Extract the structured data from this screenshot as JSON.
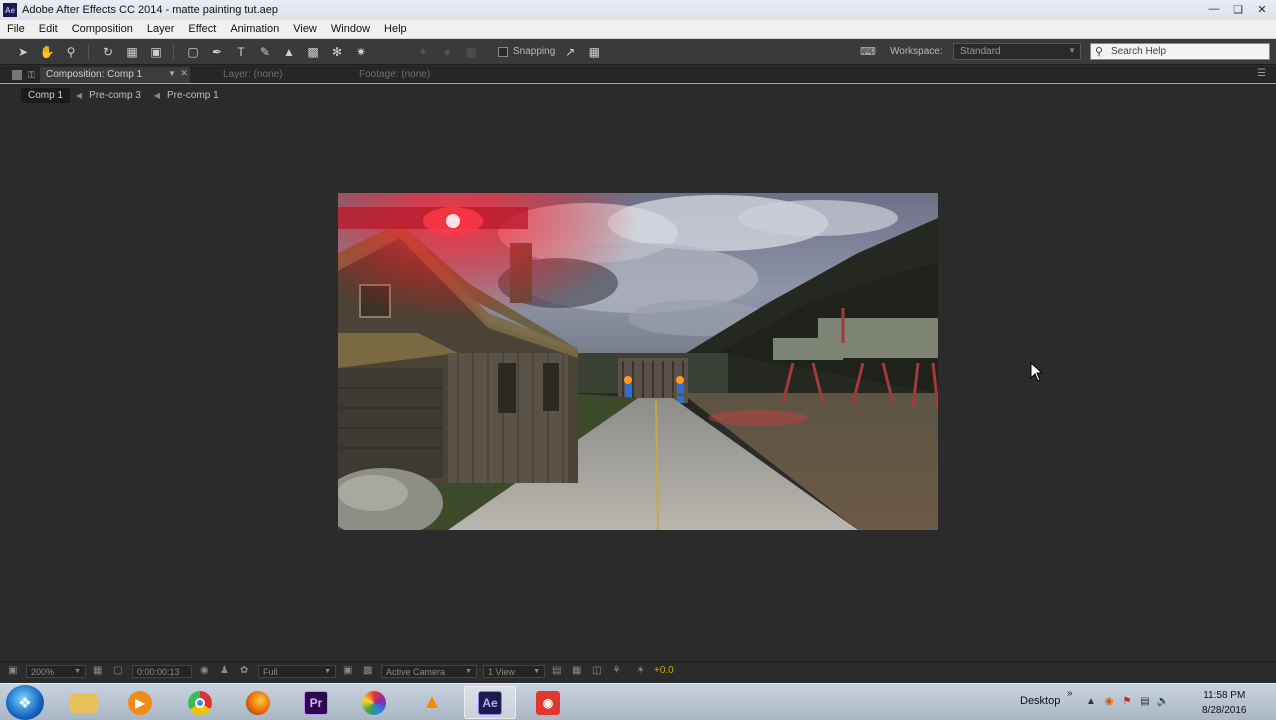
{
  "window": {
    "title": "Adobe After Effects CC 2014 - matte painting tut.aep",
    "app_icon_label": "Ae"
  },
  "menu": [
    "File",
    "Edit",
    "Composition",
    "Layer",
    "Effect",
    "Animation",
    "View",
    "Window",
    "Help"
  ],
  "toolbar": {
    "snapping_label": "Snapping",
    "workspace_label": "Workspace:",
    "workspace_value": "Standard",
    "search_placeholder": "Search Help"
  },
  "panel": {
    "comp_tab": "Composition: Comp 1",
    "layer_tab": "Layer: (none)",
    "footage_tab": "Footage: (none)"
  },
  "breadcrumbs": [
    "Comp 1",
    "Pre-comp 3",
    "Pre-comp 1"
  ],
  "viewer_footer": {
    "zoom": "200%",
    "timecode": "0:00:00:13",
    "resolution": "Full",
    "camera": "Active Camera",
    "views": "1 View",
    "exposure": "+0.0"
  },
  "taskbar": {
    "apps": [
      "file-explorer",
      "media-player",
      "chrome",
      "firefox",
      "premiere-pro",
      "app-swirl",
      "vlc",
      "after-effects",
      "recorder"
    ],
    "app_labels": {
      "premiere": "Pr",
      "after_effects": "Ae"
    },
    "desktop_label": "Desktop",
    "time": "11:58 PM",
    "date": "8/28/2016"
  },
  "colors": {
    "panel_accent": "#d7a31a",
    "ae_purple": "#1c1c4a",
    "pr_purple": "#2a0a4a"
  }
}
